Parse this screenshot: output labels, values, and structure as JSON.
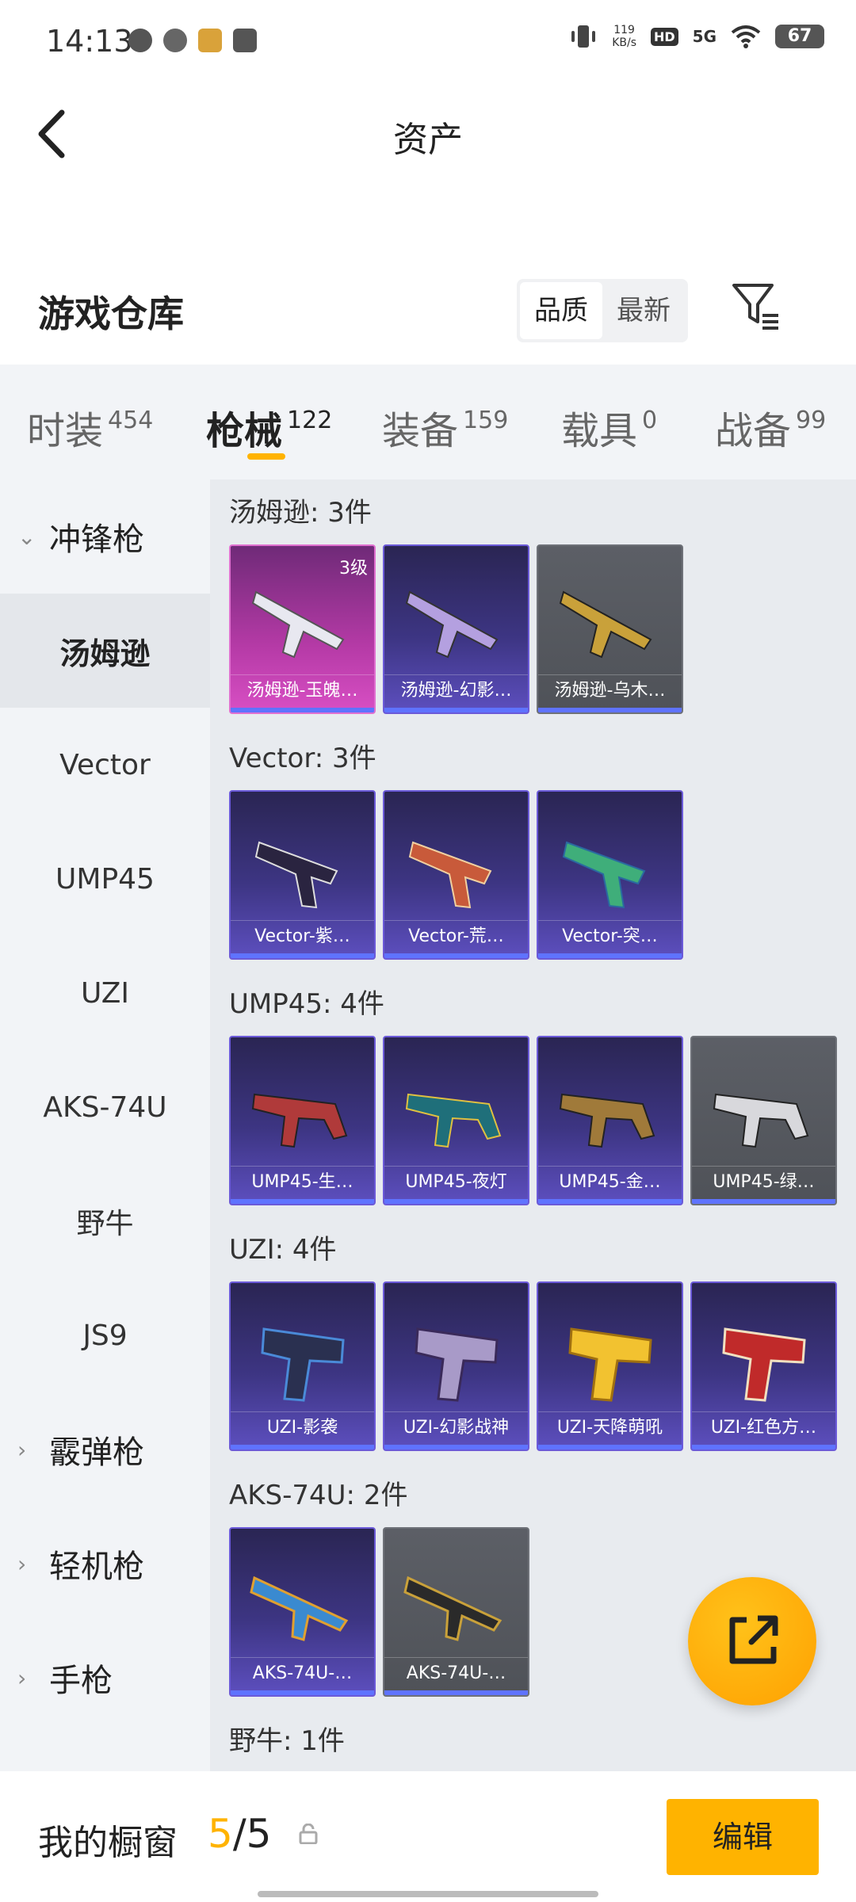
{
  "status_bar": {
    "time": "14:13",
    "net_speed": "119",
    "net_unit": "KB/s",
    "hd": "HD",
    "network": "5G",
    "battery": "67"
  },
  "header": {
    "title": "资产"
  },
  "warehouse": {
    "title": "游戏仓库",
    "sort_options": [
      "品质",
      "最新"
    ],
    "sort_selected": "品质"
  },
  "tabs": [
    {
      "label": "时装",
      "count": "454"
    },
    {
      "label": "枪械",
      "count": "122"
    },
    {
      "label": "装备",
      "count": "159"
    },
    {
      "label": "载具",
      "count": "0"
    },
    {
      "label": "战备",
      "count": "99"
    }
  ],
  "sidebar": {
    "groups": [
      {
        "label": "冲锋枪",
        "expanded": true
      },
      {
        "label": "霰弹枪",
        "expanded": false
      },
      {
        "label": "轻机枪",
        "expanded": false
      },
      {
        "label": "手枪",
        "expanded": false
      }
    ],
    "items": [
      "汤姆逊",
      "Vector",
      "UMP45",
      "UZI",
      "AKS-74U",
      "野牛",
      "JS9"
    ]
  },
  "sections": [
    {
      "title": "汤姆逊: 3件",
      "cards": [
        {
          "name": "汤姆逊-玉魄…",
          "level": "3级",
          "color": "#d84fc4"
        },
        {
          "name": "汤姆逊-幻影…",
          "color": "#5d4fbf"
        },
        {
          "name": "汤姆逊-乌木…",
          "color": "#555"
        }
      ]
    },
    {
      "title": "Vector: 3件",
      "cards": [
        {
          "name": "Vector-紫…",
          "color": "#5d4fbf"
        },
        {
          "name": "Vector-荒…",
          "color": "#5d4fbf"
        },
        {
          "name": "Vector-突…",
          "color": "#5d4fbf"
        }
      ]
    },
    {
      "title": "UMP45: 4件",
      "cards": [
        {
          "name": "UMP45-生…",
          "color": "#5d4fbf"
        },
        {
          "name": "UMP45-夜灯",
          "color": "#5d4fbf"
        },
        {
          "name": "UMP45-金…",
          "color": "#5d4fbf"
        },
        {
          "name": "UMP45-绿…",
          "color": "#555"
        }
      ]
    },
    {
      "title": "UZI: 4件",
      "cards": [
        {
          "name": "UZI-影袭",
          "color": "#5d4fbf"
        },
        {
          "name": "UZI-幻影战神",
          "color": "#5d4fbf"
        },
        {
          "name": "UZI-天降萌吼",
          "color": "#5d4fbf"
        },
        {
          "name": "UZI-红色方…",
          "color": "#5d4fbf"
        }
      ]
    },
    {
      "title": "AKS-74U: 2件",
      "cards": [
        {
          "name": "AKS-74U-…",
          "color": "#5d4fbf"
        },
        {
          "name": "AKS-74U-…",
          "color": "#555"
        }
      ]
    },
    {
      "title": "野牛: 1件",
      "cards": []
    }
  ],
  "bottom": {
    "label": "我的橱窗",
    "current": "5",
    "total": "/5",
    "edit_label": "编辑"
  },
  "colors": {
    "accent": "#ffb300",
    "purple_card": "#3d3583",
    "pink_card": "#b53aa6",
    "gray_card": "#555a60"
  }
}
